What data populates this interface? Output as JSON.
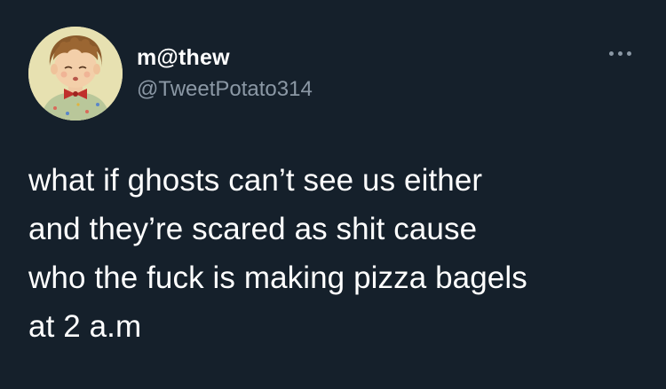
{
  "author": {
    "display_name": "m@thew",
    "handle": "@TweetPotato314",
    "avatar_icon": "cartoon-boy-avatar-icon"
  },
  "tweet": {
    "text": "what if ghosts can’t see us either\nand they’re scared as shit cause\nwho the fuck is making pizza bagels\nat 2 a.m"
  },
  "actions": {
    "more_icon": "more-options-icon"
  },
  "colors": {
    "background": "#15202b",
    "primary_text": "#ffffff",
    "secondary_text": "#8b98a5",
    "avatar_background": "#e7e1b1",
    "bow_tie": "#c0302c"
  }
}
